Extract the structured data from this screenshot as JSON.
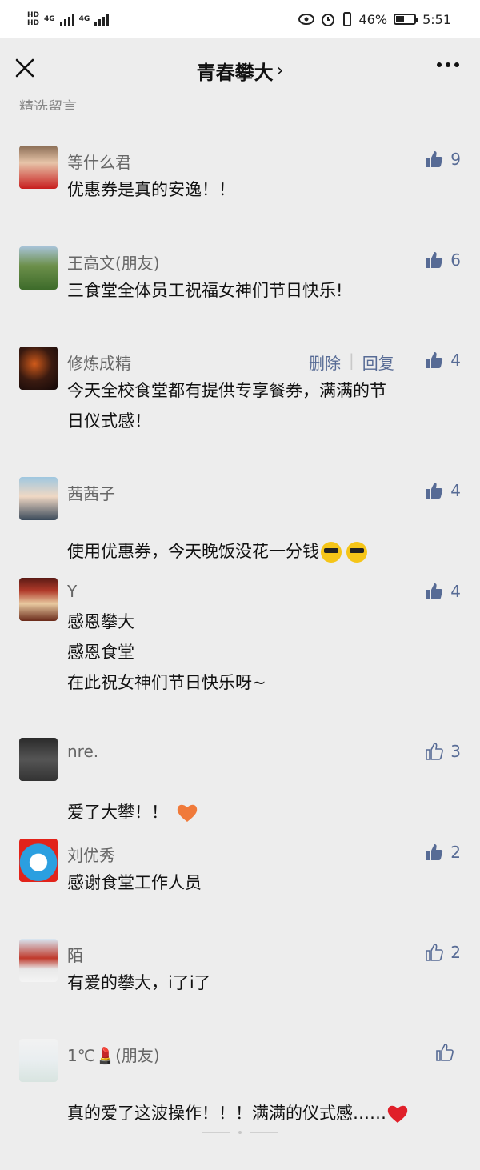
{
  "statusbar": {
    "network_a": "HD",
    "network_b": "HD",
    "signal_a": "4G",
    "signal_b": "4G",
    "battery_text": "46%",
    "time": "5:51",
    "battery_level": 0.46
  },
  "nav": {
    "title": "青春攀大",
    "chevron": "›"
  },
  "section_header": "精选留言",
  "comments": [
    {
      "name": "等什么君",
      "text": "优惠券是真的安逸！！",
      "likes": "9",
      "liked": true
    },
    {
      "name": "王高文(朋友)",
      "text": "三食堂全体员工祝福女神们节日快乐!",
      "likes": "6",
      "liked": true
    },
    {
      "name": "修炼成精",
      "text": "今天全校食堂都有提供专享餐券，满满的节\n日仪式感！",
      "likes": "4",
      "liked": true,
      "delete": "删除",
      "reply": "回复"
    },
    {
      "name": "茜茜子",
      "text": "使用优惠券，今天晚饭没花一分钱",
      "likes": "4",
      "liked": true
    },
    {
      "name": "Y",
      "text": "感恩攀大\n感恩食堂\n在此祝女神们节日快乐呀~",
      "likes": "4",
      "liked": true
    },
    {
      "name": "nre.",
      "text": "爱了大攀！！",
      "likes": "3",
      "liked": false
    },
    {
      "name": "刘优秀",
      "text": "感谢食堂工作人员",
      "likes": "2",
      "liked": true
    },
    {
      "name": "陌",
      "text": "有爱的攀大，i了i了",
      "likes": "2",
      "liked": false
    },
    {
      "name": "1℃💄(朋友)",
      "text": "真的爱了这波操作！！！满满的仪式感……",
      "likes": "",
      "liked": false
    }
  ],
  "icons": {
    "close": "close-icon",
    "more": "more-icon",
    "like": "thumbs-up-icon",
    "like_color": "#576b95"
  },
  "colors": {
    "background": "#ededed",
    "link": "#576b95",
    "text": "#111111",
    "muted": "#666666"
  }
}
